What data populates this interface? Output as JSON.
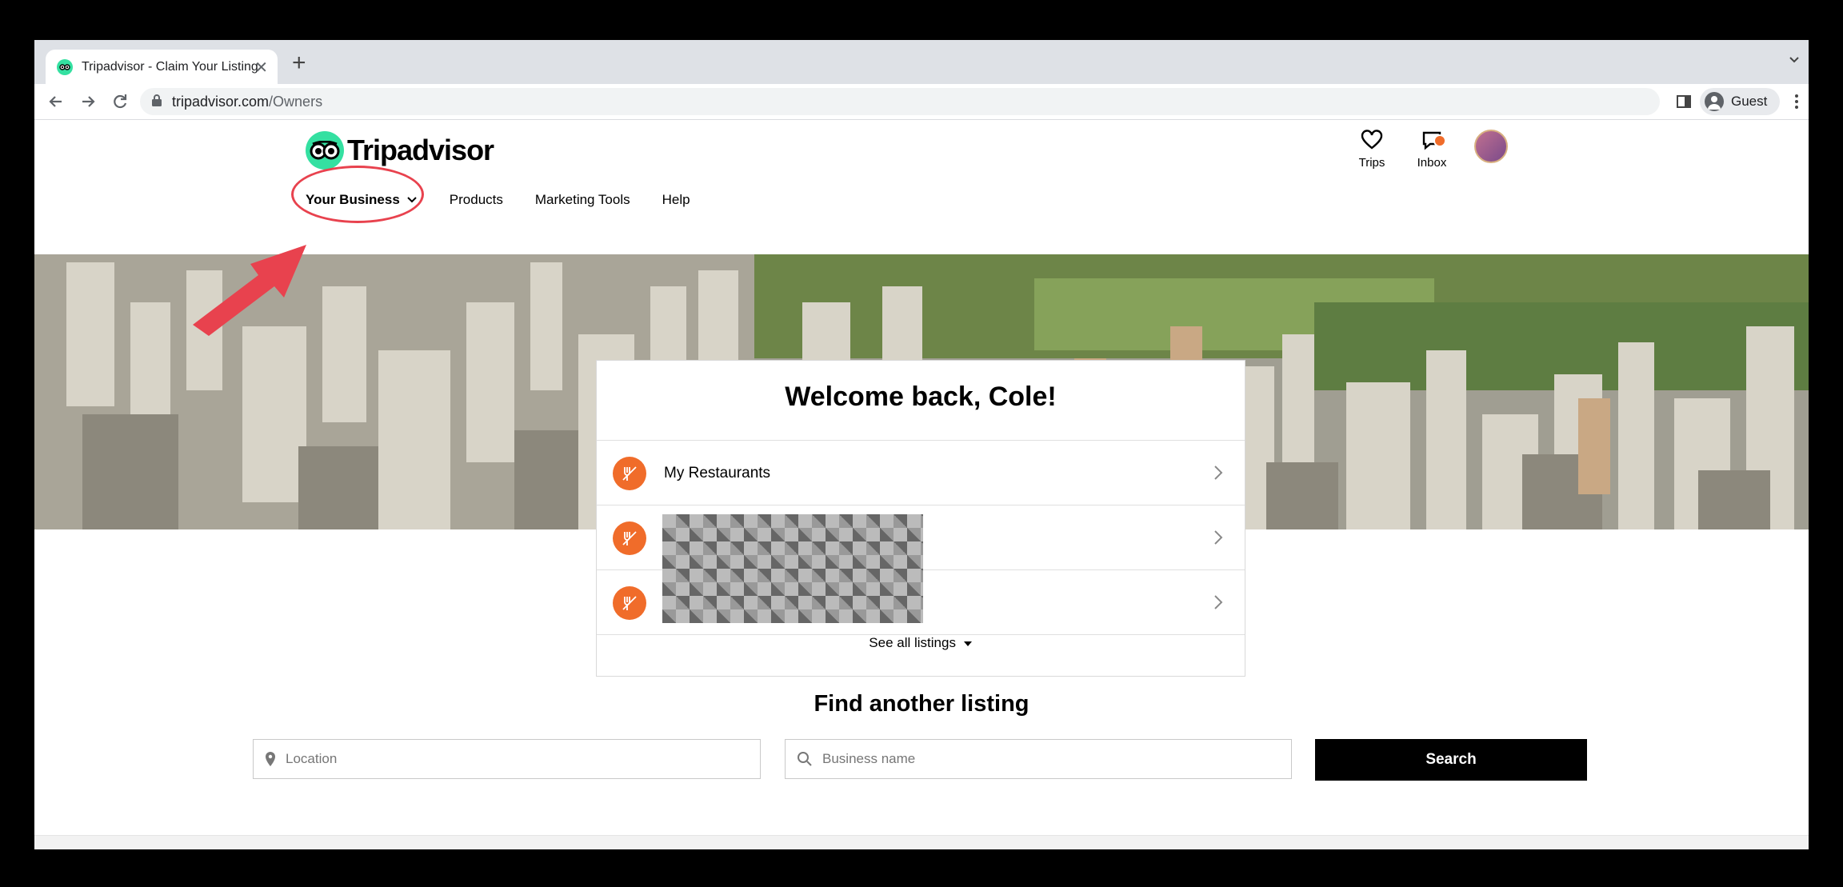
{
  "browser": {
    "tab_title": "Tripadvisor - Claim Your Listing",
    "url_host": "tripadvisor.com",
    "url_path": "/Owners",
    "profile_label": "Guest"
  },
  "header": {
    "brand": "Tripadvisor",
    "trips_label": "Trips",
    "inbox_label": "Inbox"
  },
  "nav": {
    "items": [
      "Your Business",
      "Products",
      "Marketing Tools",
      "Help"
    ]
  },
  "card": {
    "heading": "Welcome back, Cole!",
    "rows": [
      "My Restaurants",
      "",
      ""
    ],
    "see_all": "See all listings"
  },
  "find": {
    "heading": "Find another listing",
    "location_placeholder": "Location",
    "business_placeholder": "Business name",
    "search_label": "Search"
  },
  "colors": {
    "accent_green": "#34e0a1",
    "accent_orange": "#f06c2a",
    "annotation_red": "#e8424e"
  }
}
